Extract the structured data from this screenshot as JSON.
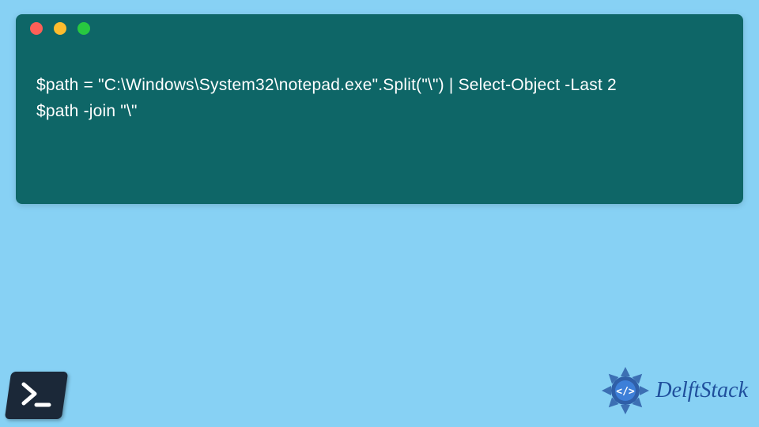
{
  "window": {
    "dots": {
      "red": "#ff5f57",
      "yellow": "#febc2e",
      "green": "#28c840"
    }
  },
  "code": {
    "line1": "$path = \"C:\\Windows\\System32\\notepad.exe\".Split(\"\\\") | Select-Object -Last 2",
    "line2": "$path -join \"\\\""
  },
  "branding": {
    "text": "DelftStack"
  }
}
